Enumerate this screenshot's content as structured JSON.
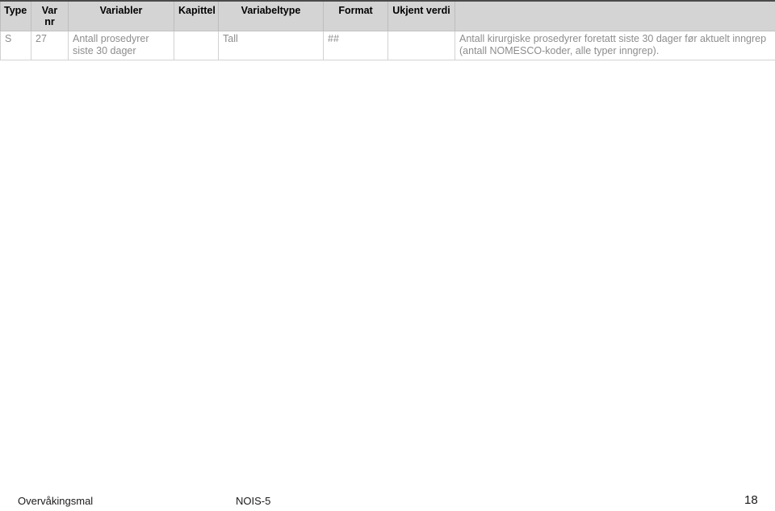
{
  "table": {
    "columns": [
      {
        "key": "type",
        "label": "Type",
        "align": "left"
      },
      {
        "key": "var_nr",
        "label": "Var nr",
        "align": "center"
      },
      {
        "key": "variabler",
        "label": "Variabler",
        "align": "center"
      },
      {
        "key": "kapittel",
        "label": "Kapittel",
        "align": "center"
      },
      {
        "key": "variabeltype",
        "label": "Variabeltype",
        "align": "center"
      },
      {
        "key": "format",
        "label": "Format",
        "align": "center"
      },
      {
        "key": "ukjent_verdi",
        "label": "Ukjent verdi",
        "align": "center"
      },
      {
        "key": "beskrivelse",
        "label": "",
        "align": "center"
      }
    ],
    "rows": [
      {
        "type": "S",
        "var_nr": "27",
        "variabler": "Antall prosedyrer siste 30 dager",
        "kapittel": "",
        "variabeltype": "Tall",
        "format": "##",
        "ukjent_verdi": "",
        "beskrivelse": "Antall kirurgiske prosedyrer foretatt siste 30 dager før aktuelt inngrep (antall NOMESCO-koder, alle typer inngrep)."
      }
    ]
  },
  "footer": {
    "left": "Overvåkingsmal",
    "center": "NOIS-5",
    "page_number": "18"
  },
  "colors": {
    "header_background": "#d4d4d4",
    "header_text": "#000000",
    "cell_text": "#8d8d8d",
    "border": "#d2d2d2",
    "top_border": "#4a4a4a",
    "page_background": "#ffffff"
  }
}
